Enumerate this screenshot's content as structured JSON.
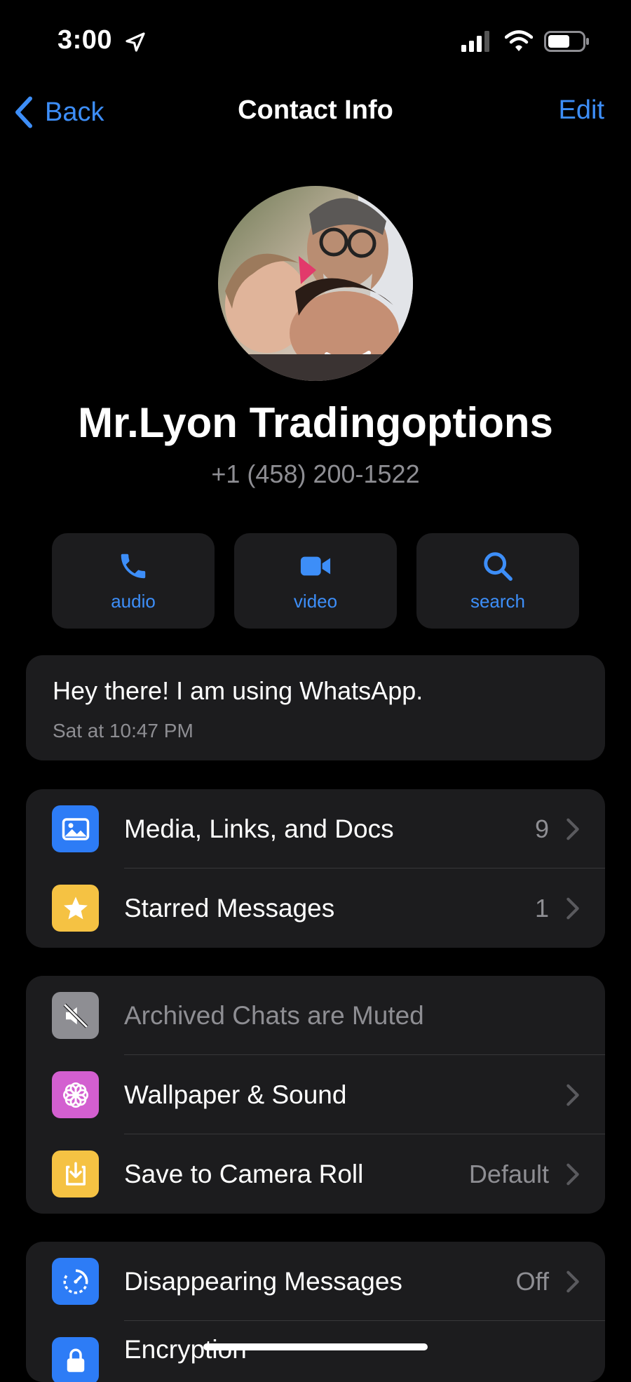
{
  "status_bar": {
    "time": "3:00"
  },
  "nav": {
    "back_label": "Back",
    "title": "Contact Info",
    "edit_label": "Edit"
  },
  "contact": {
    "name": "Mr.Lyon Tradingoptions",
    "phone": "+1 (458) 200-1522"
  },
  "actions": [
    {
      "label": "audio",
      "icon": "phone-icon"
    },
    {
      "label": "video",
      "icon": "video-camera-icon"
    },
    {
      "label": "search",
      "icon": "search-icon"
    }
  ],
  "about": {
    "text": "Hey there! I am using WhatsApp.",
    "time": "Sat at 10:47 PM"
  },
  "group1": [
    {
      "label": "Media, Links, and Docs",
      "value": "9",
      "icon": "photo-icon",
      "color": "#2d7cf6"
    },
    {
      "label": "Starred Messages",
      "value": "1",
      "icon": "star-icon",
      "color": "#f5c243"
    }
  ],
  "group2": [
    {
      "label": "Archived Chats are Muted",
      "icon": "muted-speaker-icon",
      "color": "#8e8e93"
    },
    {
      "label": "Wallpaper & Sound",
      "icon": "flower-icon",
      "color": "#d35fd0"
    },
    {
      "label": "Save to Camera Roll",
      "value": "Default",
      "icon": "download-icon",
      "color": "#f5c243"
    }
  ],
  "group3": [
    {
      "label": "Disappearing Messages",
      "value": "Off",
      "icon": "timer-icon",
      "color": "#2d7cf6"
    },
    {
      "label": "Encryption",
      "icon": "lock-icon",
      "color": "#2d7cf6"
    }
  ],
  "colors": {
    "accent": "#3d8ef8",
    "background": "#000000",
    "card": "#1c1c1e",
    "secondary_text": "#8e8e93"
  }
}
